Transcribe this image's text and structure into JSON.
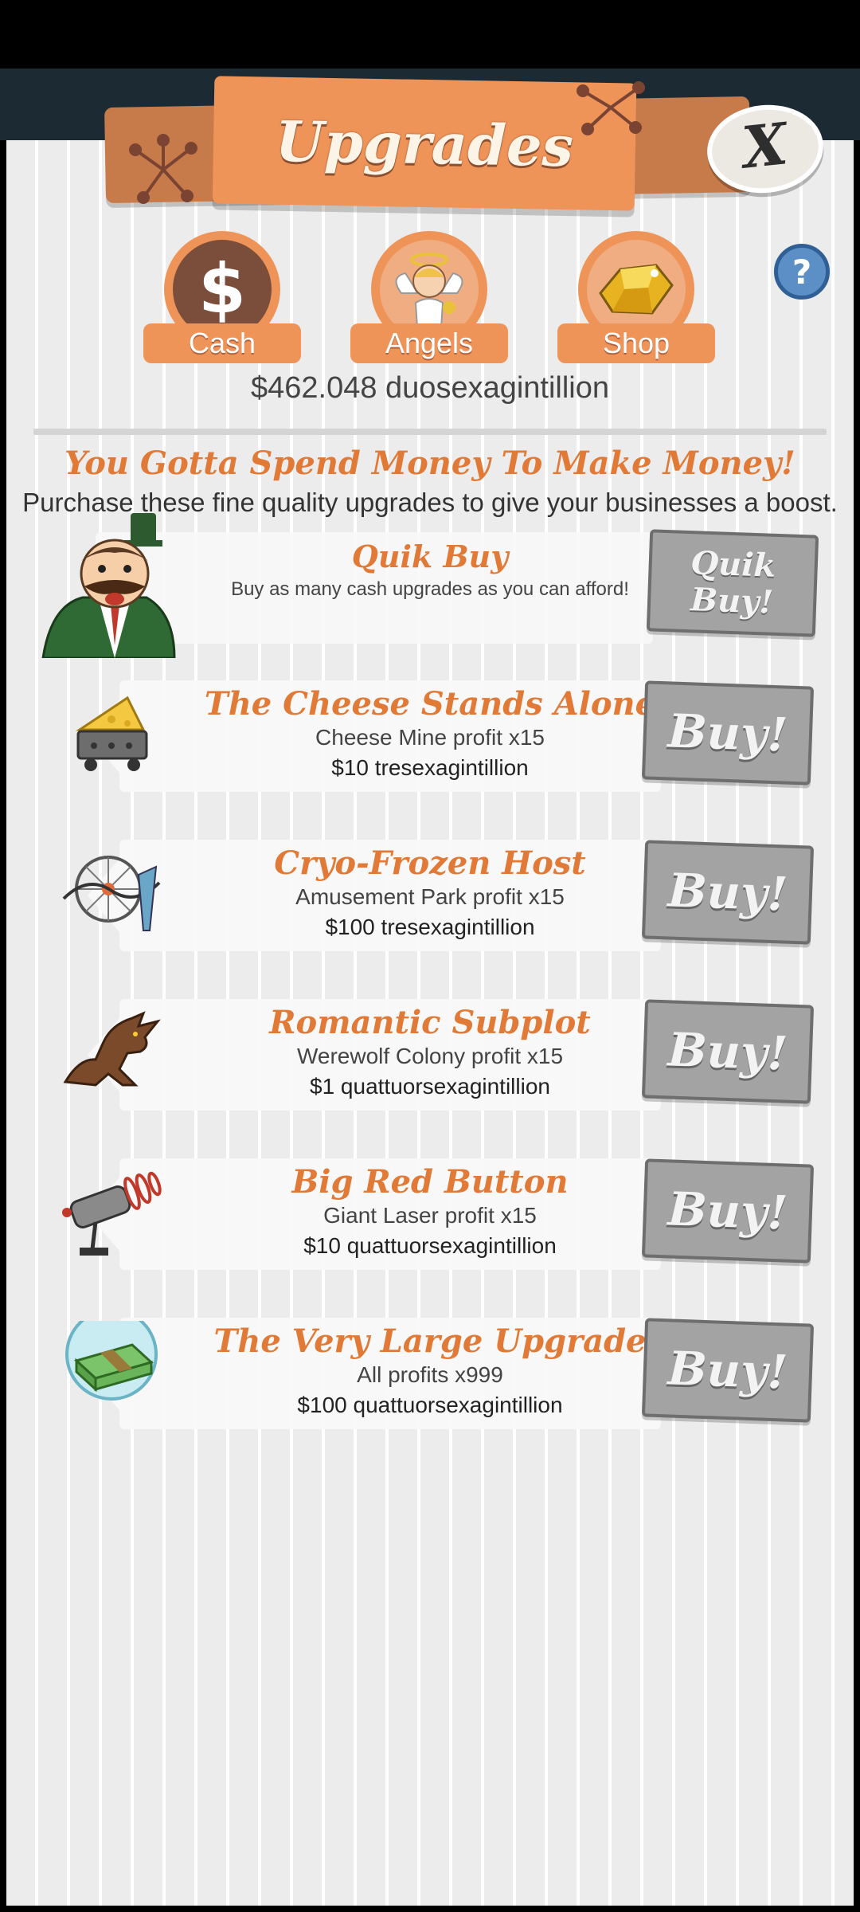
{
  "header": {
    "title": "Upgrades",
    "close_label": "X",
    "help_label": "?"
  },
  "tabs": [
    {
      "label": "Cash",
      "icon": "dollar-icon"
    },
    {
      "label": "Angels",
      "icon": "angel-icon"
    },
    {
      "label": "Shop",
      "icon": "gold-icon"
    }
  ],
  "balance": "$462.048 duosexagintillion",
  "headline": "You Gotta Spend Money To Make Money!",
  "subline": "Purchase these fine quality upgrades to give your businesses a boost.",
  "quik_buy": {
    "title": "Quik Buy",
    "description": "Buy as many cash upgrades as you can afford!",
    "button_label": "Quik\nBuy!"
  },
  "upgrades": [
    {
      "title": "The Cheese Stands Alone",
      "effect": "Cheese Mine profit x15",
      "cost": "$10 tresexagintillion",
      "button_label": "Buy!",
      "icon": "cheese-cart-icon"
    },
    {
      "title": "Cryo-Frozen Host",
      "effect": "Amusement Park profit x15",
      "cost": "$100 tresexagintillion",
      "button_label": "Buy!",
      "icon": "amusement-park-icon"
    },
    {
      "title": "Romantic Subplot",
      "effect": "Werewolf Colony profit x15",
      "cost": "$1 quattuorsexagintillion",
      "button_label": "Buy!",
      "icon": "werewolf-icon"
    },
    {
      "title": "Big Red Button",
      "effect": "Giant Laser profit x15",
      "cost": "$10 quattuorsexagintillion",
      "button_label": "Buy!",
      "icon": "laser-icon"
    },
    {
      "title": "The Very Large Upgrade",
      "effect": "All profits x999",
      "cost": "$100 quattuorsexagintillion",
      "button_label": "Buy!",
      "icon": "money-stack-icon"
    }
  ],
  "colors": {
    "accent": "#ef9458",
    "title_text": "#e07a36",
    "button_gray": "#a3a3a3"
  }
}
